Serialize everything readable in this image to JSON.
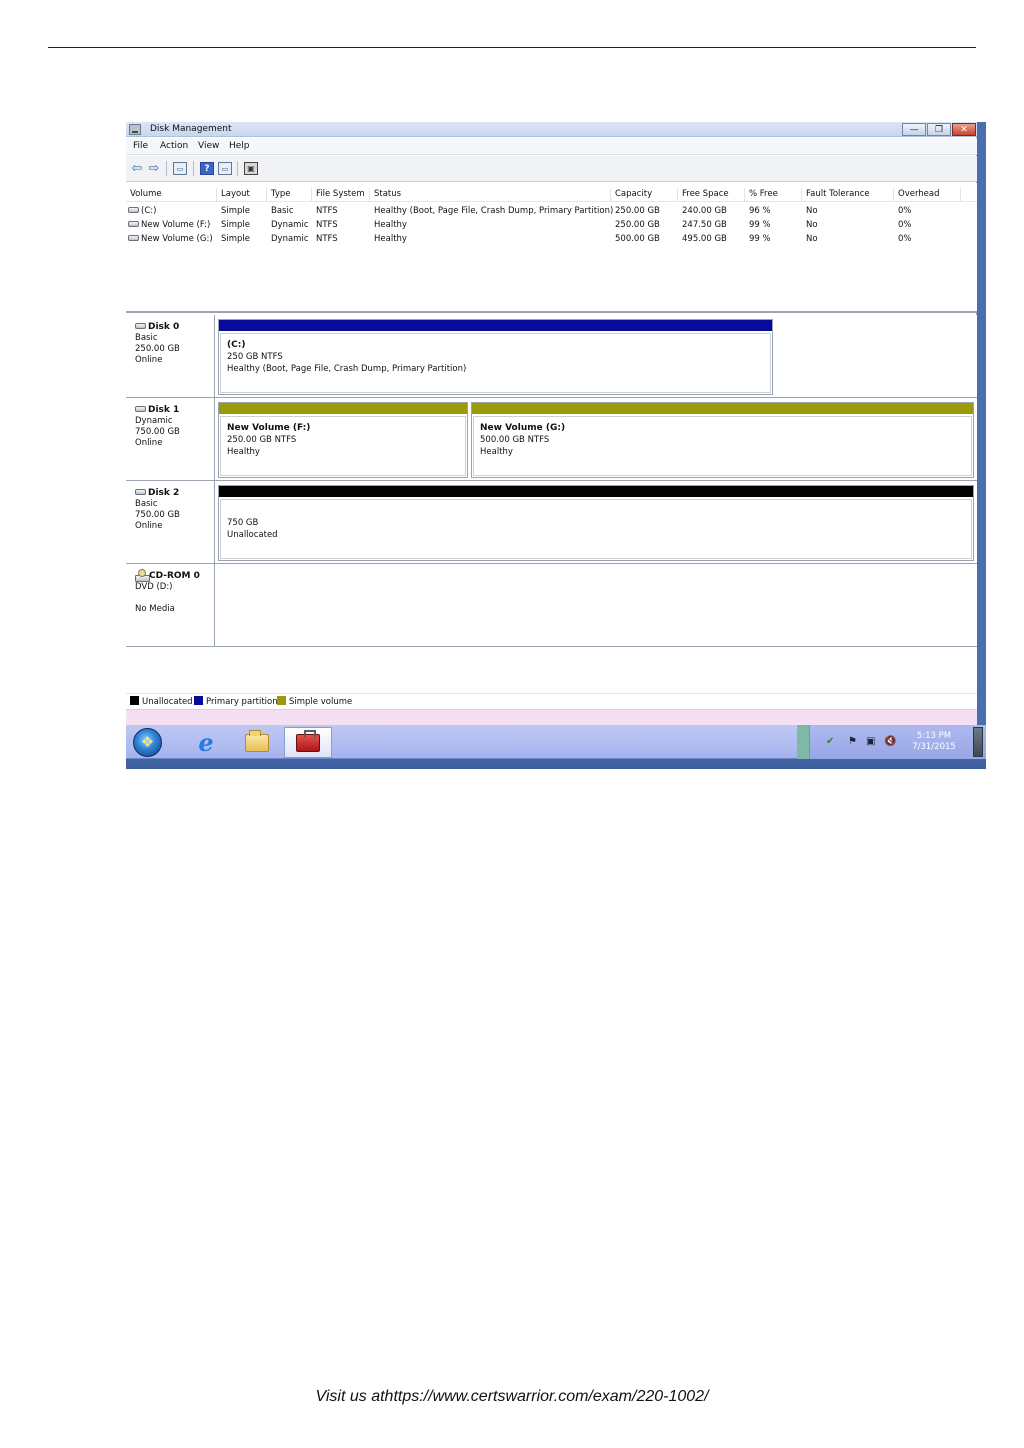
{
  "window": {
    "title": "Disk Management",
    "buttons": {
      "minimize": "—",
      "restore": "❐",
      "close": "✕"
    }
  },
  "menu": [
    "File",
    "Action",
    "View",
    "Help"
  ],
  "toolbar": {
    "icons": [
      "back-arrow-icon",
      "forward-arrow-icon",
      "console-tree-icon",
      "help-icon",
      "details-pane-icon",
      "properties-icon"
    ],
    "back": "⇦",
    "forward": "⇨",
    "help": "?",
    "pane1": "▭",
    "pane2": "▭",
    "props": "▣"
  },
  "volume_table": {
    "headers": [
      "Volume",
      "Layout",
      "Type",
      "File System",
      "Status",
      "Capacity",
      "Free Space",
      "% Free",
      "Fault Tolerance",
      "Overhead"
    ],
    "rows": [
      [
        "(C:)",
        "Simple",
        "Basic",
        "NTFS",
        "Healthy (Boot, Page File, Crash Dump, Primary Partition)",
        "250.00 GB",
        "240.00 GB",
        "96 %",
        "No",
        "0%"
      ],
      [
        "New Volume (F:)",
        "Simple",
        "Dynamic",
        "NTFS",
        "Healthy",
        "250.00 GB",
        "247.50 GB",
        "99 %",
        "No",
        "0%"
      ],
      [
        "New Volume (G:)",
        "Simple",
        "Dynamic",
        "NTFS",
        "Healthy",
        "500.00 GB",
        "495.00 GB",
        "99 %",
        "No",
        "0%"
      ]
    ]
  },
  "disks": [
    {
      "name": "Disk 0",
      "type": "Basic",
      "size": "250.00 GB",
      "state": "Online",
      "partitions": [
        {
          "title": "(C:)",
          "line1": "250 GB NTFS",
          "line2": "Healthy (Boot, Page File, Crash Dump, Primary Partition)",
          "color": "#0a0a9a"
        }
      ]
    },
    {
      "name": "Disk 1",
      "type": "Dynamic",
      "size": "750.00 GB",
      "state": "Online",
      "partitions": [
        {
          "title": "New Volume (F:)",
          "line1": "250.00 GB NTFS",
          "line2": "Healthy",
          "color": "#9a9a0a"
        },
        {
          "title": "New Volume (G:)",
          "line1": "500.00 GB NTFS",
          "line2": "Healthy",
          "color": "#9a9a0a"
        }
      ]
    },
    {
      "name": "Disk 2",
      "type": "Basic",
      "size": "750.00 GB",
      "state": "Online",
      "partitions": [
        {
          "title": "",
          "line1": "750 GB",
          "line2": "Unallocated",
          "color": "#000000"
        }
      ]
    },
    {
      "name": "CD-ROM 0",
      "type": "DVD (D:)",
      "size": "",
      "state": "No Media",
      "partitions": []
    }
  ],
  "legend": [
    {
      "label": "Unallocated",
      "color": "#000000"
    },
    {
      "label": "Primary partition",
      "color": "#0a0a9a"
    },
    {
      "label": "Simple volume",
      "color": "#9a9a0a"
    }
  ],
  "taskbar": {
    "icons": [
      "start-orb-icon",
      "internet-explorer-icon",
      "file-explorer-folder-icon",
      "computer-management-toolbox-icon"
    ],
    "ie_glyph": "e",
    "tray_icons": [
      "action-center-icon",
      "flag-icon",
      "network-icon",
      "volume-muted-icon"
    ],
    "tray_glyphs": {
      "action": "✔",
      "flag": "⚑",
      "network": "▣",
      "volume": "🔇"
    },
    "time": "5:13 PM",
    "date": "7/31/2015"
  },
  "footer": "Visit us athttps://www.certswarrior.com/exam/220-1002/"
}
